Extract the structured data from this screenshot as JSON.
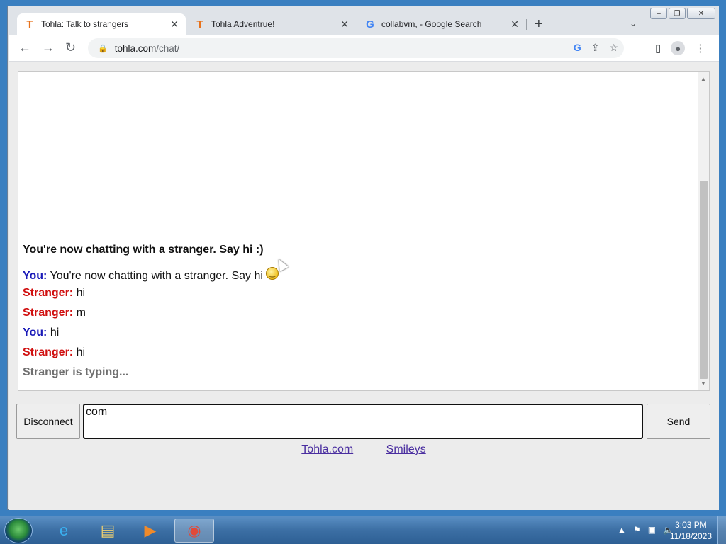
{
  "browser": {
    "tabs": [
      {
        "title": "Tohla: Talk to strangers",
        "icon": "tohla-favicon",
        "active": true
      },
      {
        "title": "Tohla Adventrue!",
        "icon": "tohla-favicon",
        "active": false
      },
      {
        "title": "collabvm, - Google Search",
        "icon": "google-favicon",
        "active": false
      }
    ],
    "url_host": "tohla.com",
    "url_path": "/chat/"
  },
  "chat": {
    "status": "You're now chatting with a stranger. Say hi :)",
    "messages": [
      {
        "sender": "You:",
        "text": "You're now chatting with a stranger. Say hi",
        "smiley": true
      },
      {
        "sender": "Stranger:",
        "text": "hi"
      },
      {
        "sender": "Stranger:",
        "text": "m"
      },
      {
        "sender": "You:",
        "text": "hi"
      },
      {
        "sender": "Stranger:",
        "text": "hi"
      }
    ],
    "typing": "Stranger is typing...",
    "input_value": "com",
    "disconnect_label": "Disconnect",
    "send_label": "Send"
  },
  "footer_links": {
    "tohla": "Tohla.com",
    "smileys": "Smileys"
  },
  "taskbar": {
    "time": "3:03 PM",
    "date": "11/18/2023"
  },
  "colors": {
    "you": "#1a1ab8",
    "stranger": "#d01010",
    "typing": "#6f6f6f",
    "link": "#4a2ea0"
  }
}
